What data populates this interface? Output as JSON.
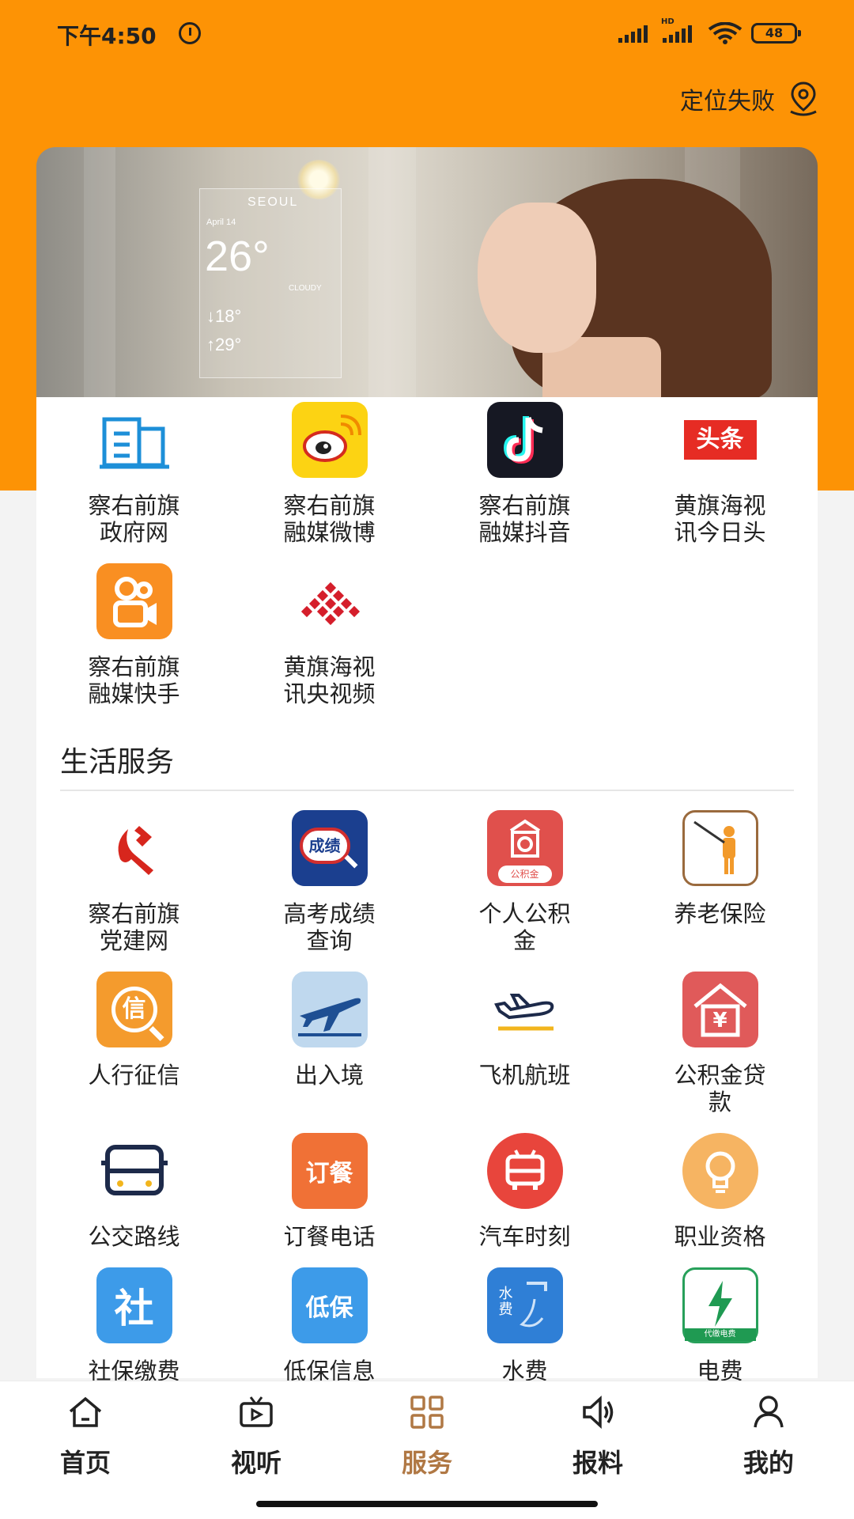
{
  "status_bar": {
    "time": "下午4:50",
    "hd_label": "HD",
    "battery": "48"
  },
  "header": {
    "location_text": "定位失败",
    "location_icon": "map-pin-icon",
    "accent_color": "#fd9305"
  },
  "banner": {
    "city": "SEOUL",
    "date": "April 14",
    "temperature": "26°",
    "condition": "CLOUDY",
    "high": "↓18°",
    "low": "↑29°"
  },
  "media_items": [
    {
      "label": "察右前旗\n政府网",
      "icon": "government-building-icon"
    },
    {
      "label": "察右前旗\n融媒微博",
      "icon": "weibo-icon"
    },
    {
      "label": "察右前旗\n融媒抖音",
      "icon": "douyin-icon"
    },
    {
      "label": "黄旗海视\n讯今日头",
      "icon": "toutiao-icon",
      "icon_text": "头条"
    },
    {
      "label": "察右前旗\n融媒快手",
      "icon": "kuaishou-icon"
    },
    {
      "label": "黄旗海视\n讯央视频",
      "icon": "cctv-video-icon"
    }
  ],
  "life_services": {
    "title": "生活服务",
    "items": [
      {
        "label": "察右前旗\n党建网",
        "icon": "party-emblem-icon"
      },
      {
        "label": "高考成绩\n查询",
        "icon": "exam-score-icon",
        "icon_text": "成绩"
      },
      {
        "label": "个人公积\n金",
        "icon": "housing-fund-icon",
        "icon_text": "公积金"
      },
      {
        "label": "养老保险",
        "icon": "pension-icon"
      },
      {
        "label": "人行征信",
        "icon": "credit-icon",
        "icon_text": "信"
      },
      {
        "label": "出入境",
        "icon": "airplane-icon"
      },
      {
        "label": "飞机航班",
        "icon": "flight-icon"
      },
      {
        "label": "公积金贷\n款",
        "icon": "house-loan-icon",
        "icon_text": "¥"
      },
      {
        "label": "公交路线",
        "icon": "bus-icon"
      },
      {
        "label": "订餐电话",
        "icon": "order-food-icon",
        "icon_text": "订餐"
      },
      {
        "label": "汽车时刻",
        "icon": "car-schedule-icon"
      },
      {
        "label": "职业资格",
        "icon": "lightbulb-icon"
      },
      {
        "label": "社保缴费",
        "icon": "social-security-icon",
        "icon_text": "社"
      },
      {
        "label": "低保信息",
        "icon": "subsistence-icon",
        "icon_text": "低保"
      },
      {
        "label": "水费",
        "icon": "water-fee-icon",
        "icon_text": "水费"
      },
      {
        "label": "电费",
        "icon": "electricity-icon",
        "icon_text": "代缴电费"
      }
    ]
  },
  "tabbar": [
    {
      "label": "首页",
      "icon": "home-icon"
    },
    {
      "label": "视听",
      "icon": "tv-play-icon"
    },
    {
      "label": "服务",
      "icon": "grid-icon",
      "active": true
    },
    {
      "label": "报料",
      "icon": "speaker-icon"
    },
    {
      "label": "我的",
      "icon": "user-icon"
    }
  ],
  "active_color": "#b07844"
}
